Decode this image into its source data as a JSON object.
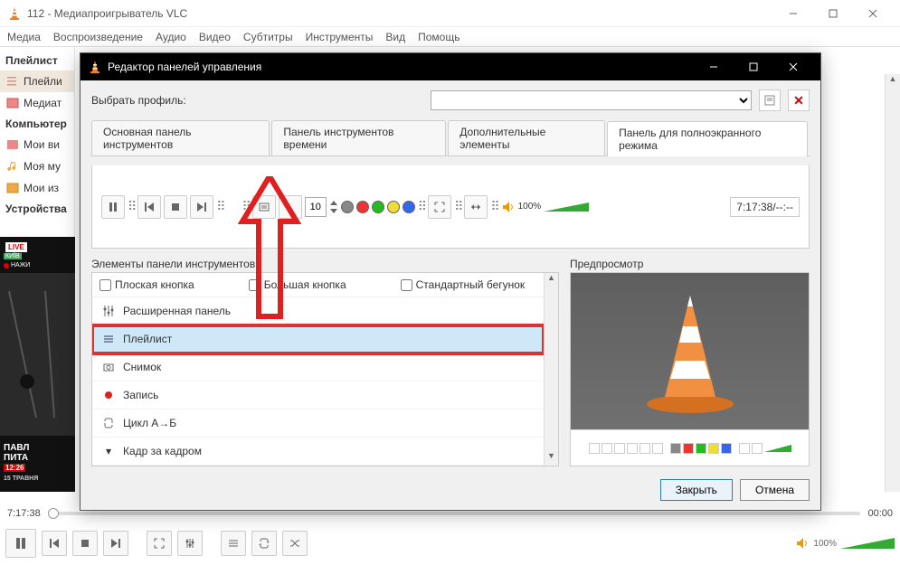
{
  "window": {
    "title": "112 - Медиапроигрыватель VLC"
  },
  "menubar": [
    "Медиа",
    "Воспроизведение",
    "Аудио",
    "Видео",
    "Субтитры",
    "Инструменты",
    "Вид",
    "Помощь"
  ],
  "sidebar": {
    "section1": "Плейлист",
    "items1": [
      "Плейли",
      "Медиат"
    ],
    "section2": "Компьютер",
    "items2": [
      "Мои ви",
      "Моя му",
      "Мои из"
    ],
    "section3": "Устройства"
  },
  "thumb": {
    "live": "LIVE",
    "city": "КИЇВ",
    "rec": "НАЖИ",
    "headline1": "ПАВЛ",
    "headline2": "ПИТА",
    "time": "12:26",
    "date": "15 ТРАВНЯ"
  },
  "seek": {
    "left": "7:17:38",
    "right": "00:00"
  },
  "volume": {
    "pct": "100%"
  },
  "dialog": {
    "title": "Редактор панелей управления",
    "profile_label": "Выбрать профиль:",
    "tabs": [
      "Основная панель инструментов",
      "Панель инструментов времени",
      "Дополнительные элементы",
      "Панель для полноэкранного режима"
    ],
    "active_tab": 3,
    "toolbar_spin": "10",
    "toolbar_vol": "100%",
    "toolbar_time": "7:17:38/--:--",
    "elements_label": "Элементы панели инструментов",
    "checks": [
      "Плоская кнопка",
      "Большая кнопка",
      "Стандартный бегунок"
    ],
    "elements": [
      {
        "label": "Расширенная панель",
        "icon": "sliders"
      },
      {
        "label": "Плейлист",
        "icon": "playlist",
        "selected": true
      },
      {
        "label": "Снимок",
        "icon": "camera"
      },
      {
        "label": "Запись",
        "icon": "record"
      },
      {
        "label": "Цикл А→Б",
        "icon": "loop"
      },
      {
        "label": "Кадр за кадром",
        "icon": "frame"
      }
    ],
    "preview_label": "Предпросмотр",
    "buttons": {
      "close": "Закрыть",
      "cancel": "Отмена"
    }
  }
}
